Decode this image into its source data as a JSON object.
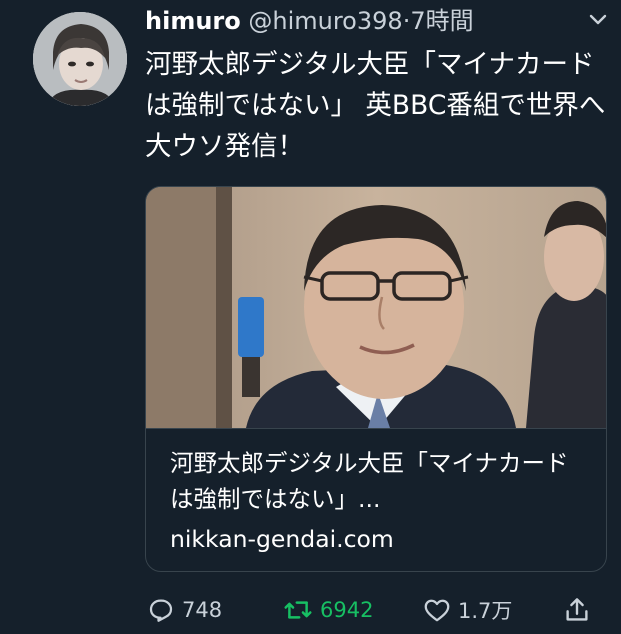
{
  "tweet": {
    "author_name": "himuro",
    "author_handle": "@himuro398",
    "separator": "·",
    "time": "7時間",
    "text": "河野太郎デジタル大臣「マイナカード は強制ではない」 英BBC番組で世界へ大ウソ発信！"
  },
  "card": {
    "title": "河野太郎デジタル大臣「マイナカードは強制ではない」...",
    "domain": "nikkan-gendai.com"
  },
  "actions": {
    "reply_count": "748",
    "retweet_count": "6942",
    "like_count": "1.7万"
  },
  "icons": {
    "caret": "chevron-down-icon",
    "reply": "reply-icon",
    "retweet": "retweet-icon",
    "like": "heart-icon",
    "share": "share-icon"
  },
  "colors": {
    "background": "#15202b",
    "retweet_active": "#17bf63",
    "secondary_text": "#c9d1d9"
  }
}
